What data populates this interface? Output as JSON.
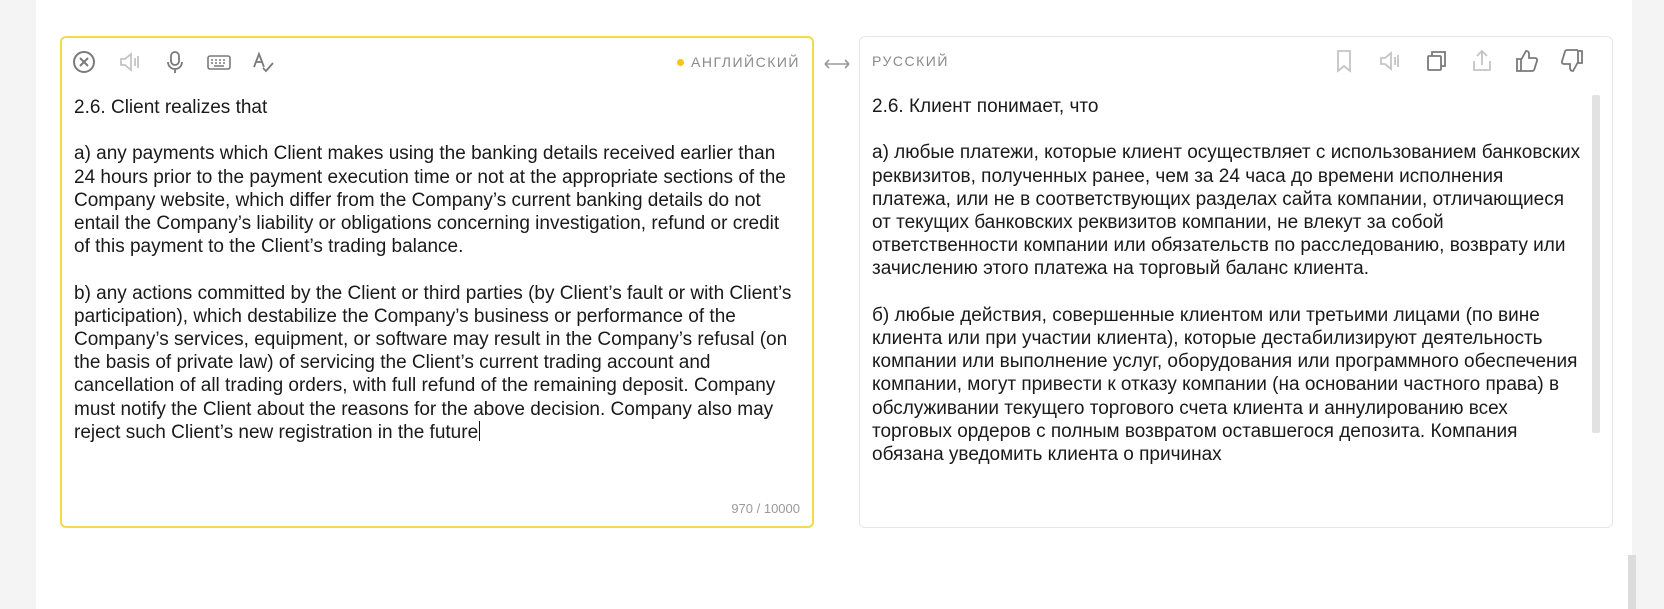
{
  "source": {
    "language": "АНГЛИЙСКИЙ",
    "text": "2.6. Client realizes that\n\na) any payments which Client makes using the banking details received earlier than 24 hours prior to the payment execution time or not at the appropriate sections of the Company website, which differ from the Company’s current banking details do not entail the Company’s liability or obligations concerning investigation, refund or credit of this payment to the Client’s trading balance.\n\nb) any actions committed by the Client or third parties (by Client’s fault or with Client’s participation), which destabilize the Company’s business or performance of the Company’s services, equipment, or software may result in the Company’s refusal (on the basis of private law) of servicing the Client’s current trading account and cancellation of all trading orders, with full refund of the remaining deposit. Company must notify the Client about the reasons for the above decision. Company also may reject such Client’s new registration in the future",
    "counter": "970 / 10000",
    "accent_color": "#f6d94a",
    "tools": [
      "clear-icon",
      "speaker-icon",
      "microphone-icon",
      "keyboard-icon",
      "spellcheck-icon"
    ]
  },
  "target": {
    "language": "РУССКИЙ",
    "text": "2.6. Клиент понимает, что\n\nа) любые платежи, которые клиент осуществляет с использованием банковских реквизитов, полученных ранее, чем за 24 часа до времени исполнения платежа, или не в соответствующих разделах сайта компании, отличающиеся от текущих банковских реквизитов компании, не влекут за собой ответственности компании или обязательств по расследованию, возврату или зачислению этого платежа на торговый баланс клиента.\n\nб) любые действия, совершенные клиентом или третьими лицами (по вине клиента или при участии клиента), которые дестабилизируют деятельность компании или выполнение услуг, оборудования или программного обеспечения компании, могут привести к отказу компании (на основании частного права) в обслуживании текущего торгового счета клиента и аннулированию всех торговых ордеров с полным возвратом оставшегося депозита. Компания обязана уведомить клиента о причинах",
    "tools": [
      "bookmark-icon",
      "speaker-icon",
      "copy-icon",
      "share-icon",
      "thumbs-up-icon",
      "thumbs-down-icon"
    ]
  },
  "swap_icon": "swap-arrows-icon"
}
